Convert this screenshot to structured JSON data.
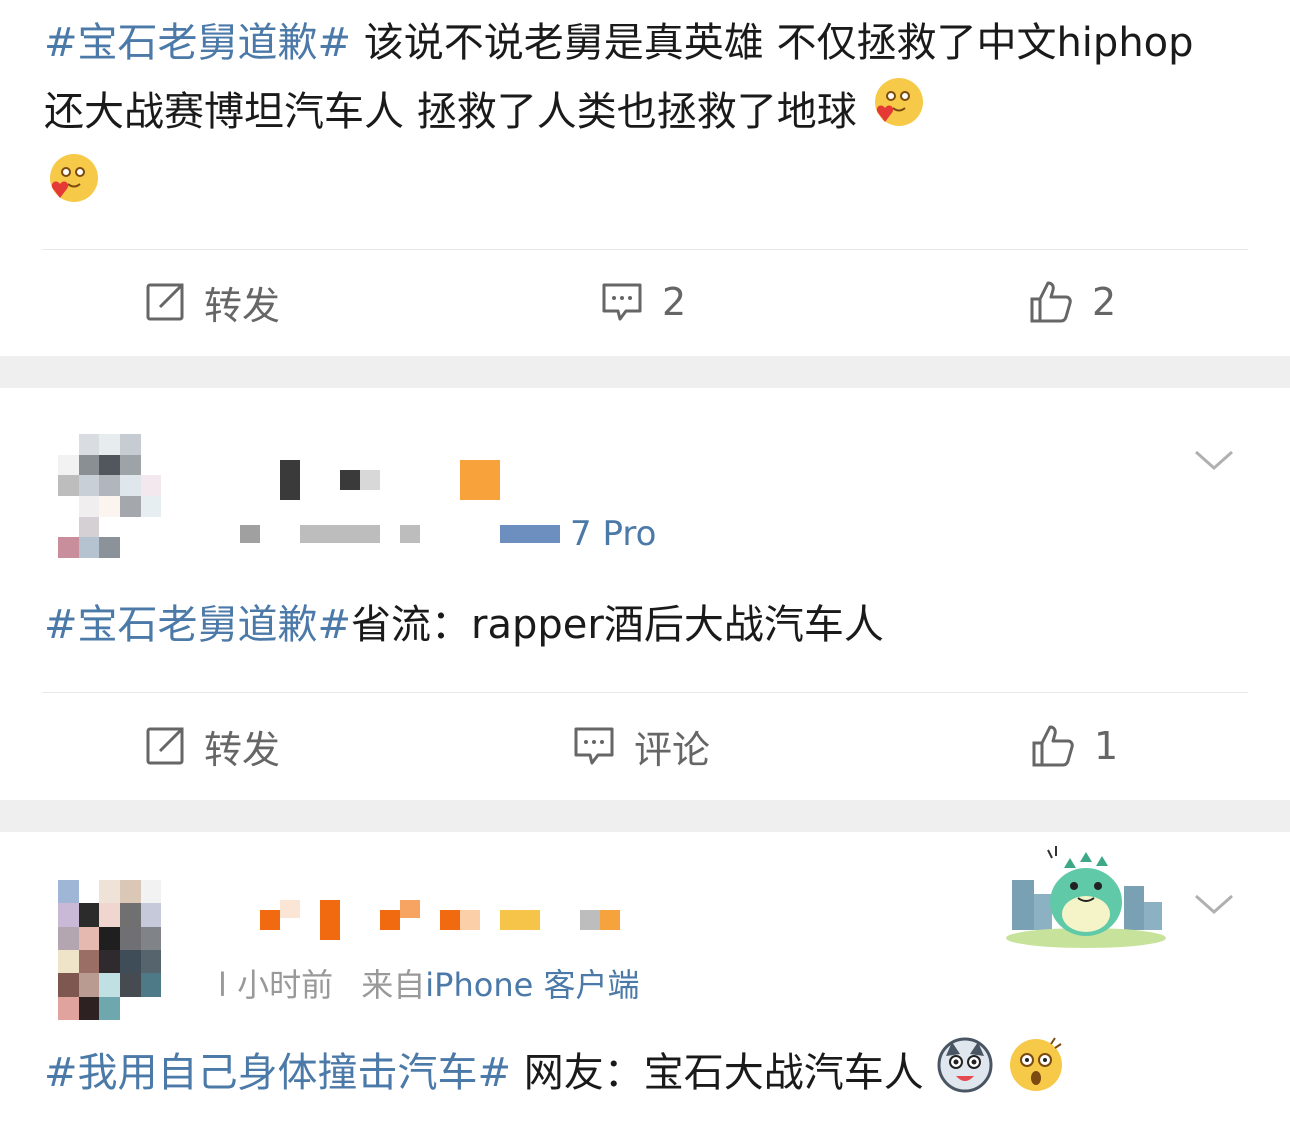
{
  "posts": [
    {
      "topic": "#宝石老舅道歉#",
      "body": " 该说不说老舅是真英雄 不仅拯救了中文hiphop 还大战赛博坦汽车人 拯救了人类也拯救了地球",
      "emojis": [
        "hug-emoji",
        "hug-emoji"
      ],
      "actions": {
        "repost": "转发",
        "comment": "2",
        "like": "2"
      }
    },
    {
      "meta_visible": "7 Pro",
      "topic": "#宝石老舅道歉#",
      "body": "省流：rapper酒后大战汽车人",
      "actions": {
        "repost": "转发",
        "comment": "评论",
        "like": "1"
      }
    },
    {
      "meta_time": "l 小时前",
      "meta_from": "来自",
      "meta_source": "iPhone 客户端",
      "topic": "#我用自己身体撞击汽车#",
      "body": " 网友：宝石大战汽车人",
      "emojis": [
        "husky-emoji",
        "shocked-emoji"
      ]
    }
  ],
  "colors": {
    "topic": "#4b79a8",
    "separator": "#efefef",
    "action_text": "#666666"
  }
}
